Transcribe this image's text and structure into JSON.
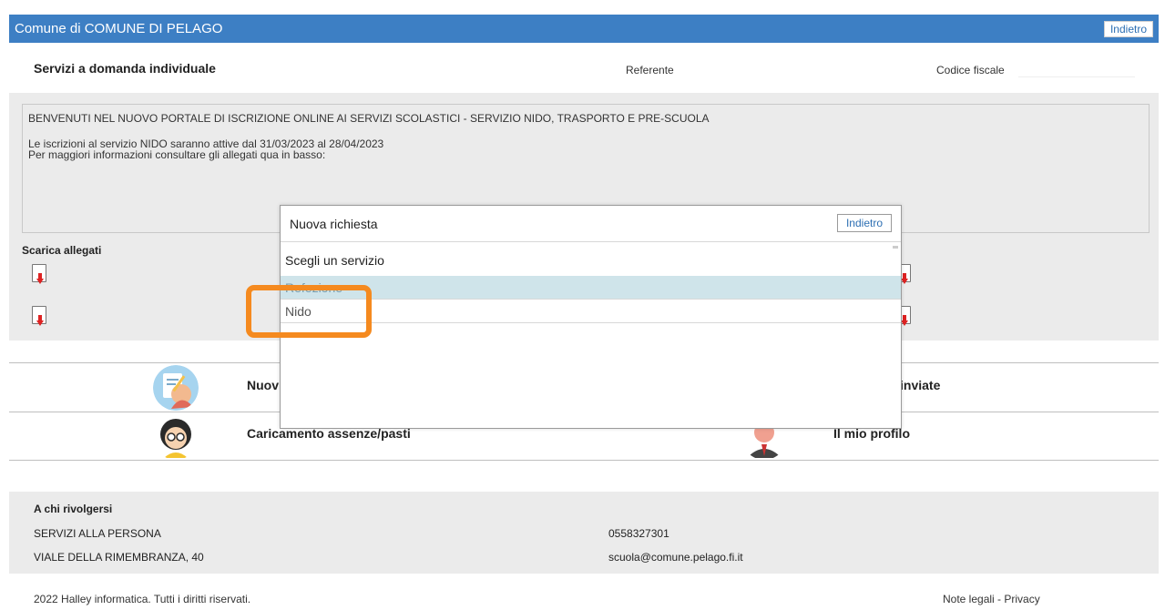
{
  "header": {
    "title": "Comune di COMUNE DI PELAGO",
    "back_label": "Indietro"
  },
  "subheader": {
    "page_title": "Servizi a domanda individuale",
    "referente_label": "Referente",
    "codice_fiscale_label": "Codice fiscale"
  },
  "notice": {
    "line1": "BENVENUTI NEL NUOVO PORTALE DI ISCRIZIONE ONLINE AI SERVIZI SCOLASTICI - SERVIZIO NIDO, TRASPORTO E PRE-SCUOLA",
    "line2": "Le iscrizioni al servizio NIDO saranno attive dal 31/03/2023 al 28/04/2023",
    "line3": "Per maggiori informazioni consultare gli allegati qua in basso:"
  },
  "allegati": {
    "title": "Scarica allegati"
  },
  "menu": {
    "nuova": "Nuov",
    "inviate": "inviate",
    "assenze": "Caricamento assenze/pasti",
    "profilo": "Il mio profilo"
  },
  "footer": {
    "title": "A chi rivolgersi",
    "office": "SERVIZI ALLA PERSONA",
    "address": "VIALE DELLA RIMEMBRANZA, 40",
    "phone": "0558327301",
    "email": "scuola@comune.pelago.fi.it",
    "copyright": "2022 Halley informatica. Tutti i diritti riservati.",
    "legal": "Note legali - Privacy"
  },
  "modal": {
    "title": "Nuova richiesta",
    "back_label": "Indietro",
    "select_heading": "Scegli un servizio",
    "options": [
      "Refezione",
      "Nido"
    ]
  },
  "colors": {
    "header_bg": "#3d7fc4",
    "highlight_option": "#cfe4ea",
    "annotation_orange": "#f58a1f"
  }
}
